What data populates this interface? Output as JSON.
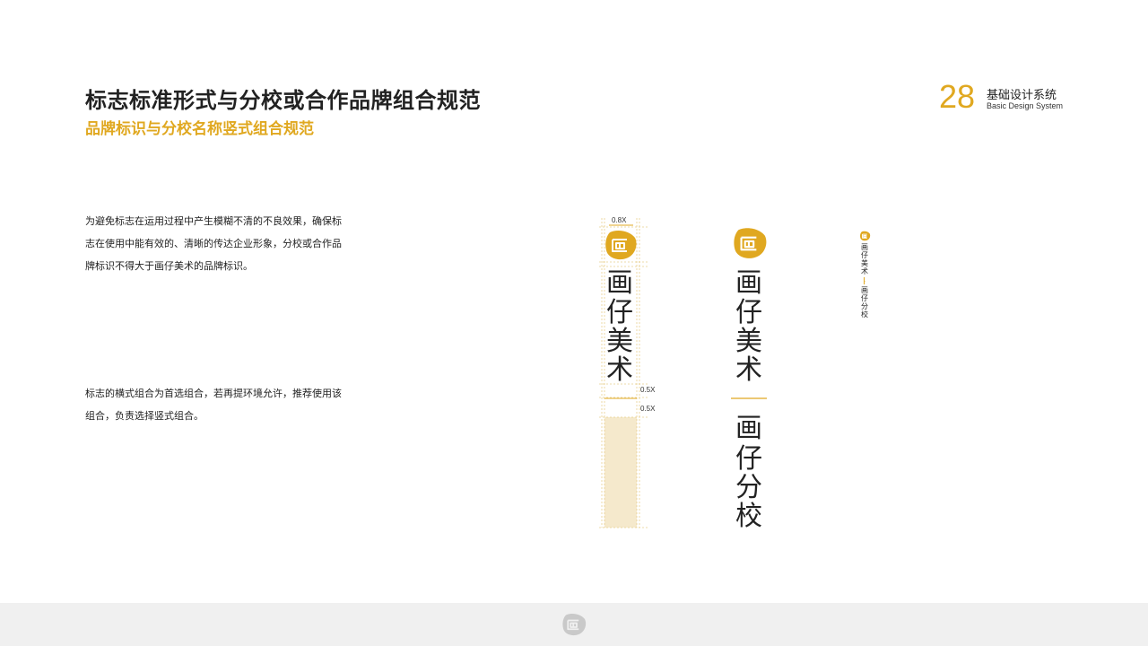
{
  "header": {
    "title": "标志标准形式与分校或合作品牌组合规范",
    "subtitle": "品牌标识与分校名称竖式组合规范",
    "page_number": "28",
    "section_title": "基础设计系统",
    "section_subtitle": "Basic Design System"
  },
  "body": {
    "paragraph_1": "为避免标志在运用过程中产生模糊不清的不良效果，确保标志在使用中能有效的、清晰的传达企业形象，分校或合作品牌标识不得大于画仔美术的品牌标识。",
    "paragraph_2": "标志的横式组合为首选组合，若再提环境允许，推荐使用该组合，负责选择竖式组合。"
  },
  "diagram": {
    "dim_top": "0.8X",
    "dim_mid_1": "0.5X",
    "dim_mid_2": "0.5X",
    "brand_chars": [
      "画",
      "仔",
      "美",
      "术"
    ],
    "branch_chars": [
      "画",
      "仔",
      "分",
      "校"
    ]
  },
  "colors": {
    "accent": "#e0a820",
    "highlight": "#f5e9cc",
    "footer_bg": "#f0f0f0"
  },
  "icons": {
    "brand_logo": "hua-zai-logo-icon",
    "footer_logo": "hua-zai-logo-icon"
  }
}
